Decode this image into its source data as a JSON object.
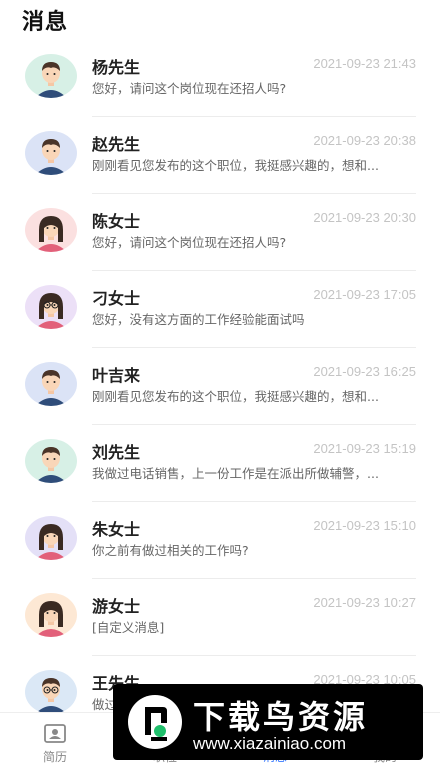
{
  "header": {
    "title": "消息"
  },
  "messages": [
    {
      "name": "杨先生",
      "time": "2021-09-23 21:43",
      "preview": "您好，请问这个岗位现在还招人吗?",
      "avatar_icon": "male-avatar-icon",
      "avatar_bg": "#d7f0e6"
    },
    {
      "name": "赵先生",
      "time": "2021-09-23 20:38",
      "preview": "刚刚看见您发布的这个职位，我挺感兴趣的，想和...",
      "avatar_icon": "male-avatar-icon",
      "avatar_bg": "#dbe3f6"
    },
    {
      "name": "陈女士",
      "time": "2021-09-23 20:30",
      "preview": "您好，请问这个岗位现在还招人吗?",
      "avatar_icon": "female-avatar-icon",
      "avatar_bg": "#fbe0e0"
    },
    {
      "name": "刁女士",
      "time": "2021-09-23 17:05",
      "preview": "您好，没有这方面的工作经验能面试吗",
      "avatar_icon": "female-glasses-avatar-icon",
      "avatar_bg": "#ece0f7"
    },
    {
      "name": "叶吉来",
      "time": "2021-09-23 16:25",
      "preview": "刚刚看见您发布的这个职位，我挺感兴趣的，想和...",
      "avatar_icon": "male-avatar-icon",
      "avatar_bg": "#dbe3f6"
    },
    {
      "name": "刘先生",
      "time": "2021-09-23 15:19",
      "preview": "我做过电话销售，上一份工作是在派出所做辅警，...",
      "avatar_icon": "male-avatar-icon",
      "avatar_bg": "#d7f0e6"
    },
    {
      "name": "朱女士",
      "time": "2021-09-23 15:10",
      "preview": "你之前有做过相关的工作吗?",
      "avatar_icon": "female-avatar-icon",
      "avatar_bg": "#e4e0f7"
    },
    {
      "name": "游女士",
      "time": "2021-09-23 10:27",
      "preview": "[自定义消息]",
      "avatar_icon": "female-avatar-icon",
      "avatar_bg": "#fde8d4"
    },
    {
      "name": "王先生",
      "time": "2021-09-23 10:05",
      "preview": "做过...",
      "avatar_icon": "male-glasses-avatar-icon",
      "avatar_bg": "#dbe8f6"
    }
  ],
  "tabbar": {
    "tabs": [
      {
        "label": "简历",
        "icon": "resume-icon"
      },
      {
        "label": "职位",
        "icon": "briefcase-icon"
      },
      {
        "label": "消息",
        "icon": "chat-icon"
      },
      {
        "label": "我的",
        "icon": "user-icon"
      }
    ],
    "active_color": "#3a7bff"
  },
  "watermark": {
    "title": "下载鸟资源",
    "url": "www.xiazainiao.com"
  }
}
